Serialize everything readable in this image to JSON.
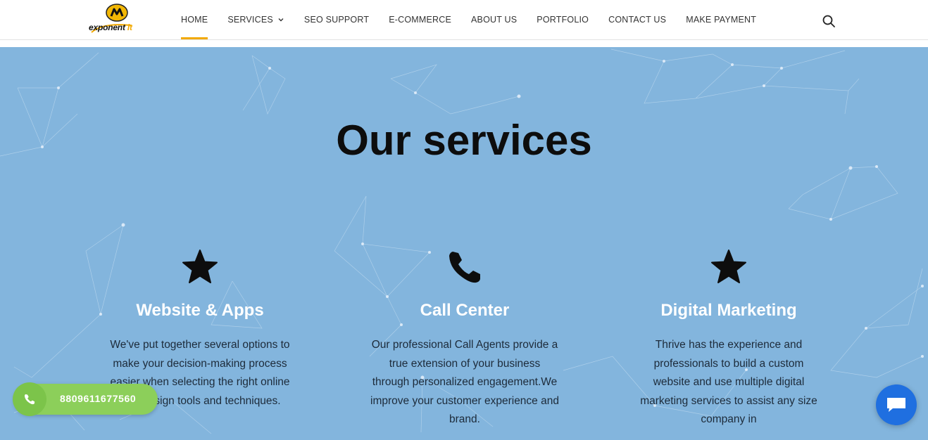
{
  "header": {
    "logo": {
      "name": "exponent it",
      "text_main": "exponent ",
      "text_accent": "it"
    },
    "nav": [
      {
        "label": "HOME",
        "active": true
      },
      {
        "label": "SERVICES",
        "has_dropdown": true
      },
      {
        "label": "SEO SUPPORT"
      },
      {
        "label": "E-COMMERCE"
      },
      {
        "label": "ABOUT US"
      },
      {
        "label": "PORTFOLIO"
      },
      {
        "label": "CONTACT US"
      },
      {
        "label": "MAKE PAYMENT"
      }
    ],
    "search_icon": "search-icon"
  },
  "hero": {
    "title": "Our services",
    "background_color": "#83b5dd"
  },
  "services": [
    {
      "icon": "star-icon",
      "title": "Website & Apps",
      "description": "We've put together several options to make your decision-making process easier when selecting the right online web design tools and techniques."
    },
    {
      "icon": "phone-icon",
      "title": "Call Center",
      "description": "Our professional Call Agents provide a true extension of your business through personalized engagement.We improve your customer experience and brand."
    },
    {
      "icon": "star-icon",
      "title": "Digital Marketing",
      "description": "Thrive has the experience and professionals to build a custom website and use multiple digital marketing services to assist any size company in"
    }
  ],
  "floating": {
    "phone_number": "8809611677560",
    "phone_icon": "phone-icon",
    "chat_icon": "chat-icon"
  },
  "colors": {
    "accent": "#f2a900",
    "phone_button": "#8ccf5a",
    "chat_button": "#1f6fe0"
  }
}
